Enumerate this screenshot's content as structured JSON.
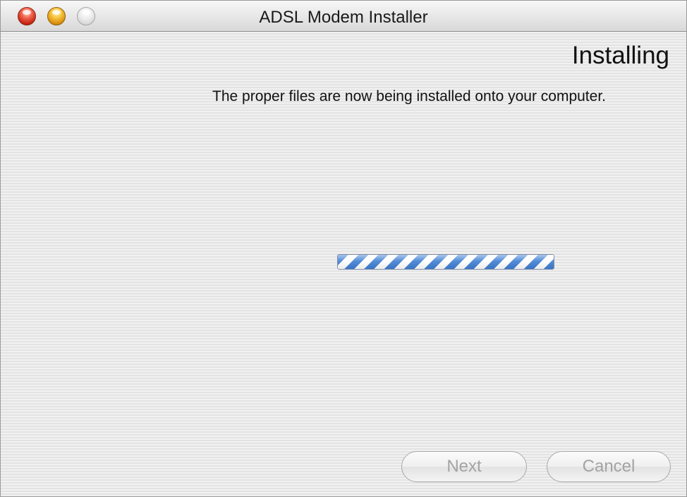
{
  "window": {
    "title": "ADSL Modem Installer"
  },
  "page": {
    "heading": "Installing",
    "description": "The proper files are now being installed onto your computer."
  },
  "progress": {
    "value": 1.0,
    "style": "indeterminate",
    "color": "#3f7fd3"
  },
  "buttons": {
    "next_label": "Next",
    "cancel_label": "Cancel",
    "disabled_text_color": "#a3a3a3"
  },
  "traffic_lights": {
    "close_icon": "close-icon",
    "minimize_icon": "minimize-icon",
    "zoom_icon": "zoom-icon",
    "close_color": "#e0432e",
    "minimize_color": "#f5b52a",
    "zoom_color": "#e6e6e6"
  }
}
